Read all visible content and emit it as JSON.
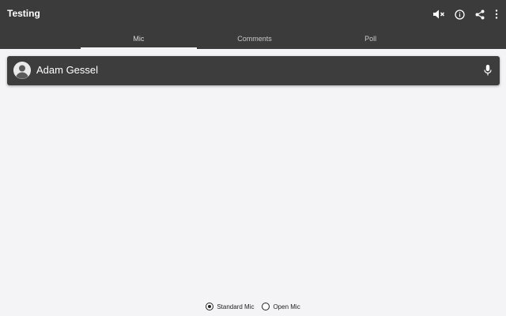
{
  "app": {
    "title": "Testing"
  },
  "actions": [
    {
      "icon": "volume-mute-icon"
    },
    {
      "icon": "info-icon"
    },
    {
      "icon": "share-icon"
    },
    {
      "icon": "more-vert-icon"
    }
  ],
  "tabs": [
    {
      "label": "Mic",
      "active": true
    },
    {
      "label": "Comments",
      "active": false
    },
    {
      "label": "Poll",
      "active": false
    }
  ],
  "speaker": {
    "name": "Adam Gessel",
    "icon": "mic-icon"
  },
  "mic_mode": {
    "options": [
      {
        "label": "Standard Mic",
        "selected": true
      },
      {
        "label": "Open Mic",
        "selected": false
      }
    ]
  },
  "colors": {
    "appbar": "#3b3b3b",
    "card": "#3d3d3d",
    "background": "#f4f4f6",
    "text_light": "#ffffff"
  }
}
